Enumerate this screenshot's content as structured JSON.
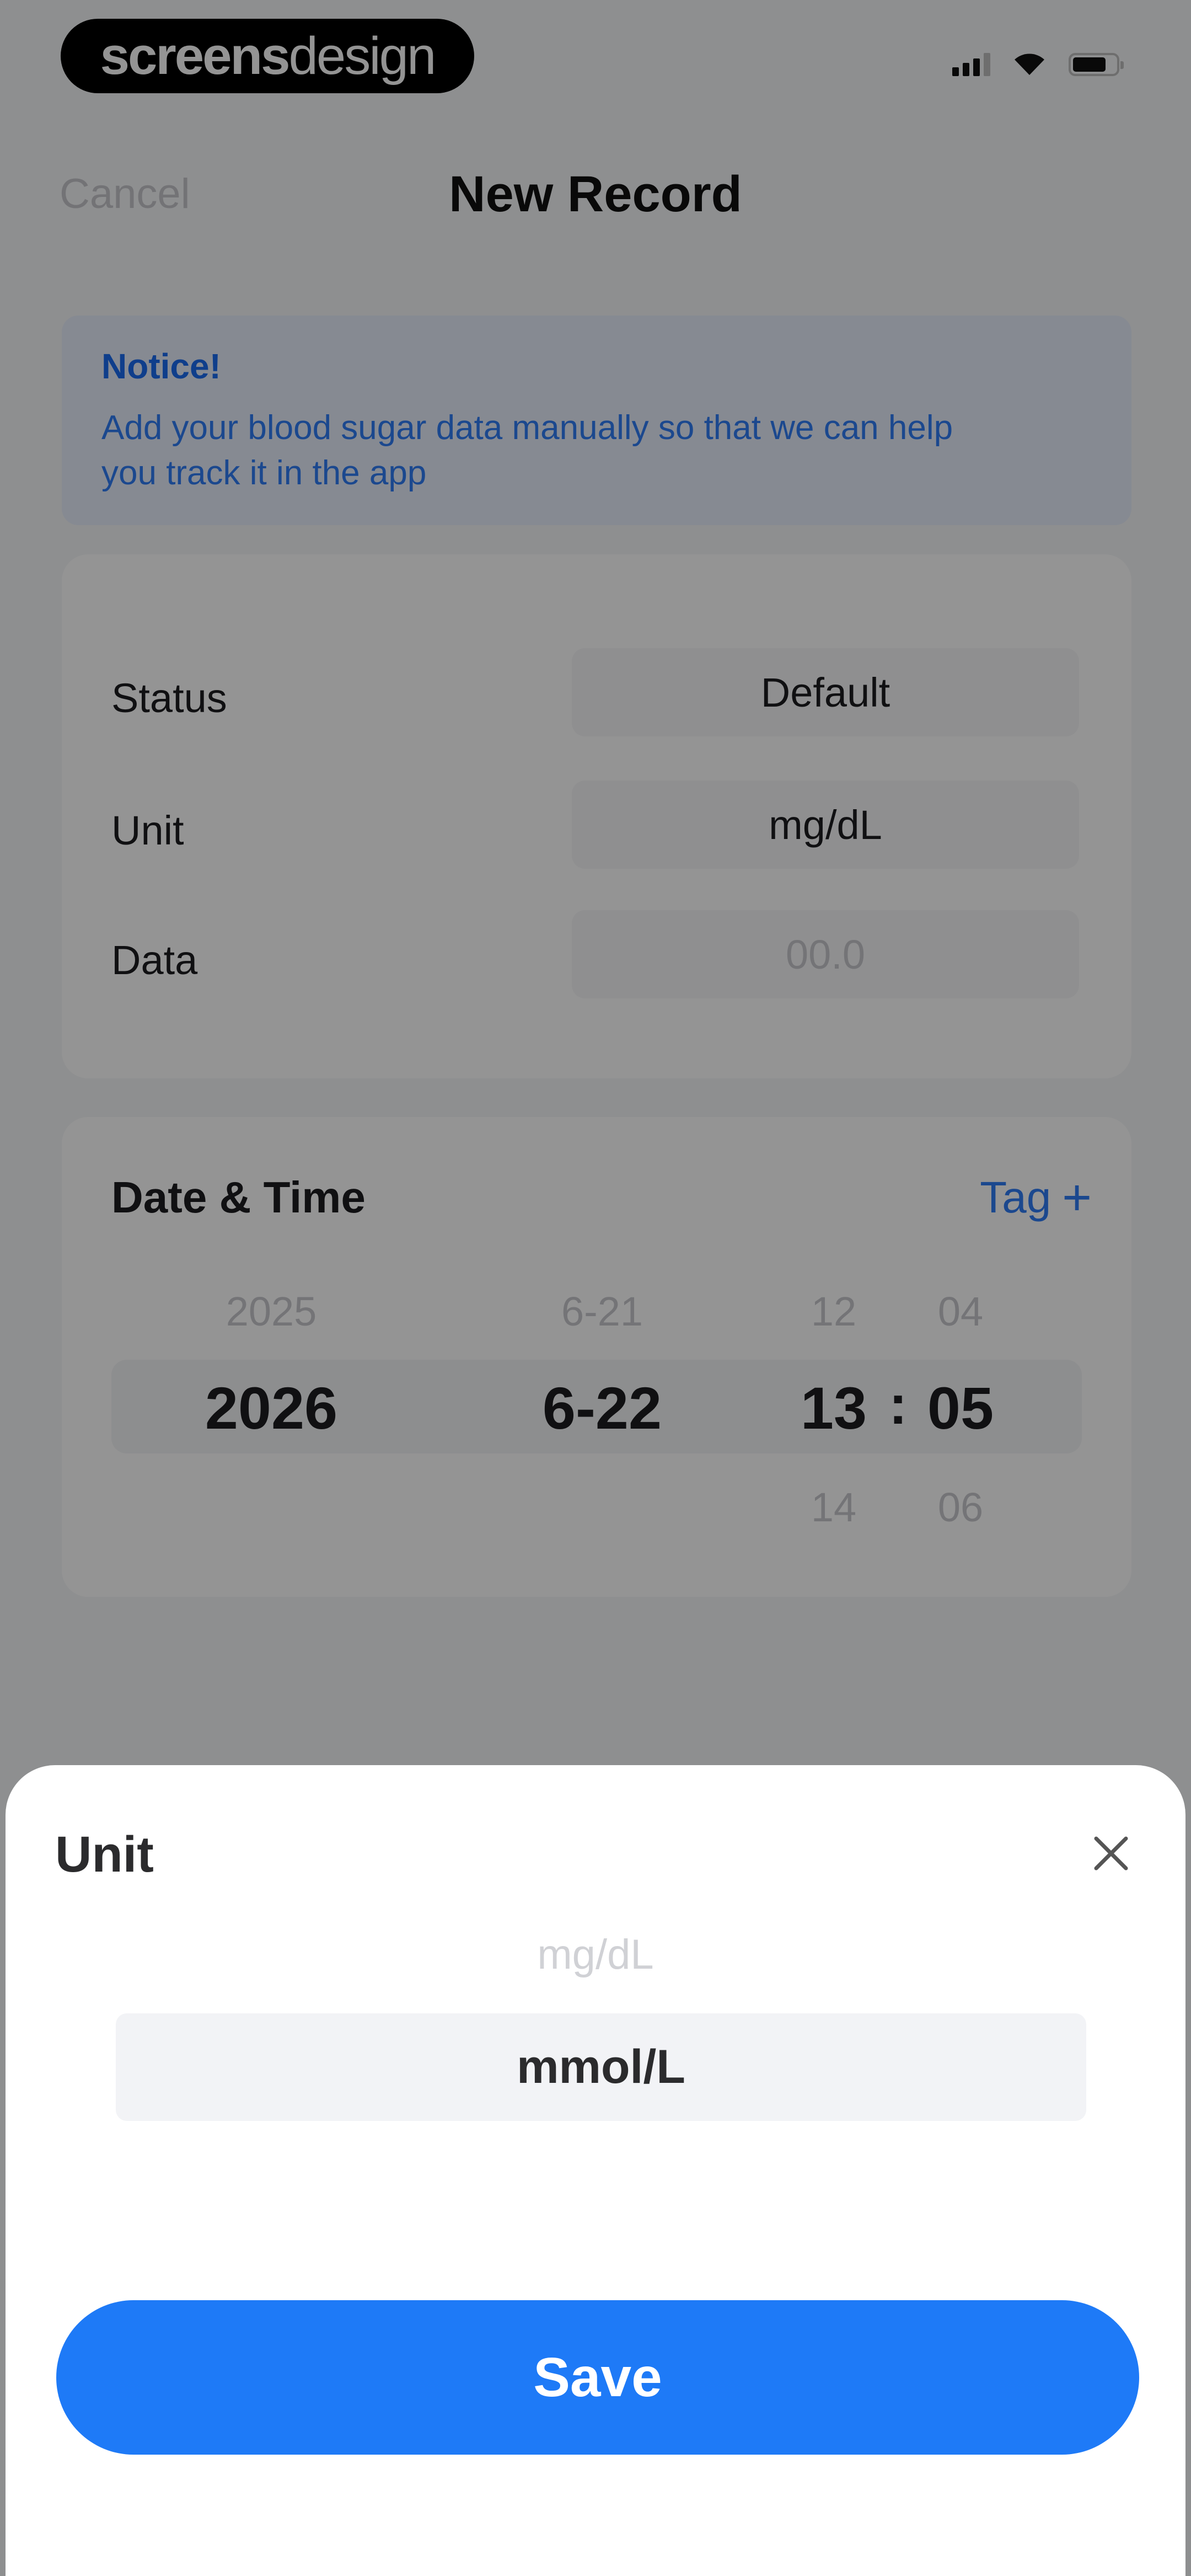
{
  "brand": {
    "part1": "screens",
    "part2": "design"
  },
  "nav": {
    "cancel": "Cancel",
    "title": "New Record"
  },
  "notice": {
    "title": "Notice!",
    "line1": "Add your blood sugar data manually so that we can help",
    "line2": "you track it in the app"
  },
  "form": {
    "status_label": "Status",
    "status_value": "Default",
    "unit_label": "Unit",
    "unit_value": "mg/dL",
    "data_label": "Data",
    "data_placeholder": "00.0"
  },
  "datetime": {
    "title": "Date & Time",
    "tag_label": "Tag",
    "tag_plus": "+",
    "year_prev": "2025",
    "year": "2026",
    "date_prev": "6-21",
    "date": "6-22",
    "hour_prev": "12",
    "hour": "13",
    "hour_next": "14",
    "min_prev": "04",
    "min": "05",
    "min_next": "06",
    "separator": ":"
  },
  "sheet": {
    "title": "Unit",
    "option_above": "mg/dL",
    "option_selected": "mmol/L",
    "save_label": "Save"
  },
  "colors": {
    "accent": "#1e7af7",
    "overlay": "rgba(0,0,0,0.42)",
    "notice_bg": "#e7eefb"
  }
}
